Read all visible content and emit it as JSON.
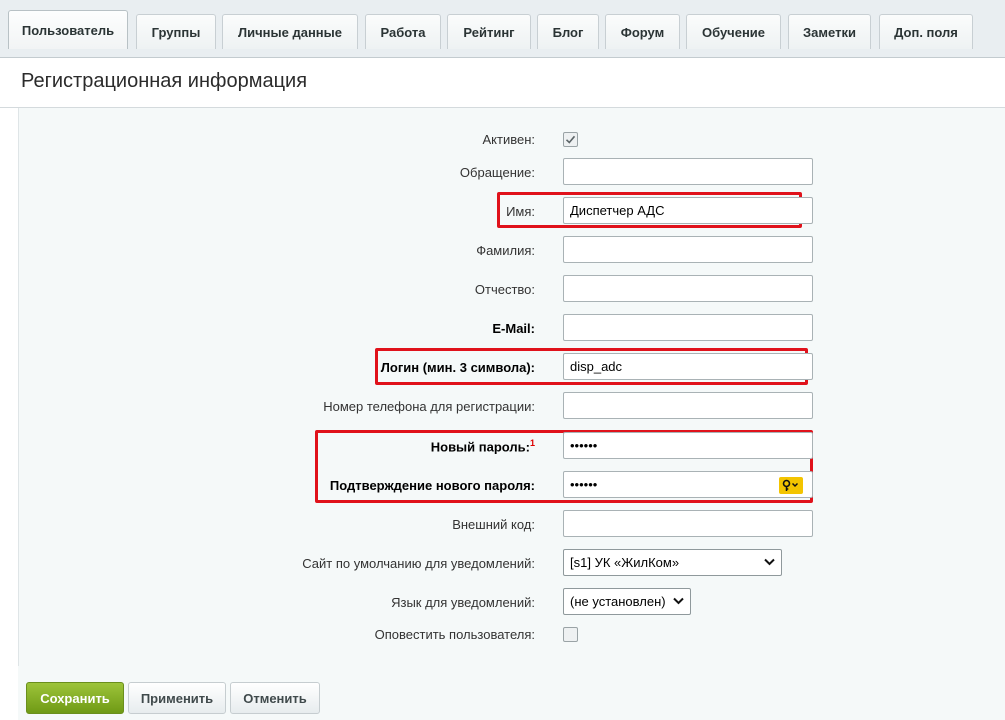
{
  "tabs": [
    {
      "label": "Пользователь"
    },
    {
      "label": "Группы"
    },
    {
      "label": "Личные данные"
    },
    {
      "label": "Работа"
    },
    {
      "label": "Рейтинг"
    },
    {
      "label": "Блог"
    },
    {
      "label": "Форум"
    },
    {
      "label": "Обучение"
    },
    {
      "label": "Заметки"
    },
    {
      "label": "Доп. поля"
    }
  ],
  "section_title": "Регистрационная информация",
  "fields": {
    "active": {
      "label": "Активен:",
      "checked": true
    },
    "salutation": {
      "label": "Обращение:",
      "value": ""
    },
    "name": {
      "label": "Имя:",
      "value": "Диспетчер АДС"
    },
    "last_name": {
      "label": "Фамилия:",
      "value": ""
    },
    "second_name": {
      "label": "Отчество:",
      "value": ""
    },
    "email": {
      "label": "E-Mail:",
      "value": ""
    },
    "login": {
      "label": "Логин (мин. 3 символа):",
      "value": "disp_adc"
    },
    "phone": {
      "label": "Номер телефона для регистрации:",
      "value": ""
    },
    "new_password": {
      "label": "Новый пароль:",
      "footnote": "1",
      "value": "••••••"
    },
    "confirm_password": {
      "label": "Подтверждение нового пароля:",
      "value": "••••••"
    },
    "external_code": {
      "label": "Внешний код:",
      "value": ""
    },
    "default_site": {
      "label": "Сайт по умолчанию для уведомлений:",
      "value": "[s1] УК «ЖилКом»"
    },
    "language": {
      "label": "Язык для уведомлений:",
      "value": "(не установлен)"
    },
    "notify_user": {
      "label": "Оповестить пользователя:",
      "checked": false
    }
  },
  "buttons": {
    "save": "Сохранить",
    "apply": "Применить",
    "cancel": "Отменить"
  },
  "colors": {
    "highlight": "#e0121b",
    "save_button": "#7aa51f",
    "key_button": "#f3c400"
  }
}
